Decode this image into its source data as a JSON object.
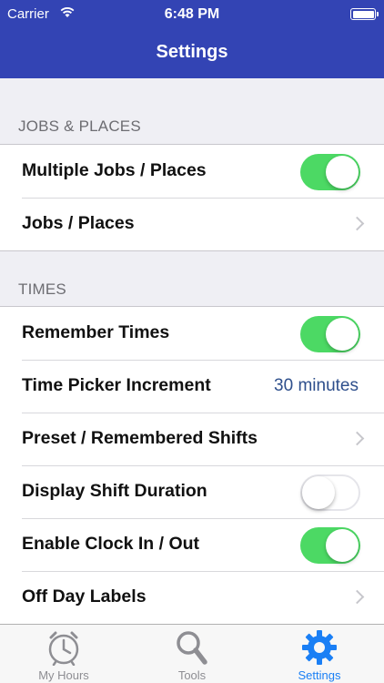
{
  "status_bar": {
    "carrier": "Carrier",
    "time": "6:48 PM"
  },
  "nav": {
    "title": "Settings"
  },
  "sections": {
    "jobs": {
      "header": "JOBS & PLACES",
      "rows": [
        {
          "label": "Multiple Jobs / Places",
          "toggle": true
        },
        {
          "label": "Jobs / Places"
        }
      ]
    },
    "times": {
      "header": "TIMES",
      "rows": [
        {
          "label": "Remember Times",
          "toggle": true
        },
        {
          "label": "Time Picker Increment",
          "value": "30 minutes"
        },
        {
          "label": "Preset / Remembered Shifts"
        },
        {
          "label": "Display Shift Duration",
          "toggle": false
        },
        {
          "label": "Enable Clock In / Out",
          "toggle": true
        },
        {
          "label": "Off Day Labels"
        }
      ]
    }
  },
  "tab_bar": {
    "tabs": [
      {
        "label": "My Hours",
        "icon": "clock-icon"
      },
      {
        "label": "Tools",
        "icon": "search-icon"
      },
      {
        "label": "Settings",
        "icon": "gear-icon",
        "active": true
      }
    ]
  },
  "colors": {
    "nav_background": "#3344b4",
    "toggle_on": "#4cd964",
    "value_text": "#2e4f8c",
    "active_tab": "#1a7ff5"
  }
}
